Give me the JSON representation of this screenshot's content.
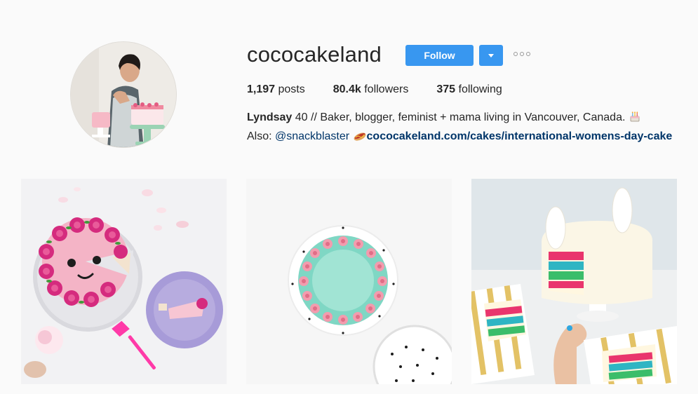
{
  "profile": {
    "username": "cococakeland",
    "follow_label": "Follow",
    "stats": {
      "posts_count": "1,197",
      "posts_label": " posts",
      "followers_count": "80.4k",
      "followers_label": " followers",
      "following_count": "375",
      "following_label": " following"
    },
    "bio": {
      "name": "Lyndsay",
      "line1_text": " 40 // Baker, blogger, feminist + mama living in Vancouver, Canada. ",
      "also_label": "Also: ",
      "mention": "@snackblaster",
      "link": "cococakeland.com/cakes/international-womens-day-cake"
    }
  },
  "icons": {
    "dropdown": "chevron-down-icon",
    "more": "more-options-icon",
    "cake_emoji": "cake-emoji-icon",
    "hotdog_emoji": "hotdog-emoji-icon"
  },
  "posts": [
    {
      "subject": "pink rose cake with smile face"
    },
    {
      "subject": "mint green cake with pink roses"
    },
    {
      "subject": "llama rainbow layer cake"
    }
  ],
  "colors": {
    "accent": "#3897f0",
    "link": "#003569",
    "text": "#262626",
    "background": "#fafafa"
  }
}
